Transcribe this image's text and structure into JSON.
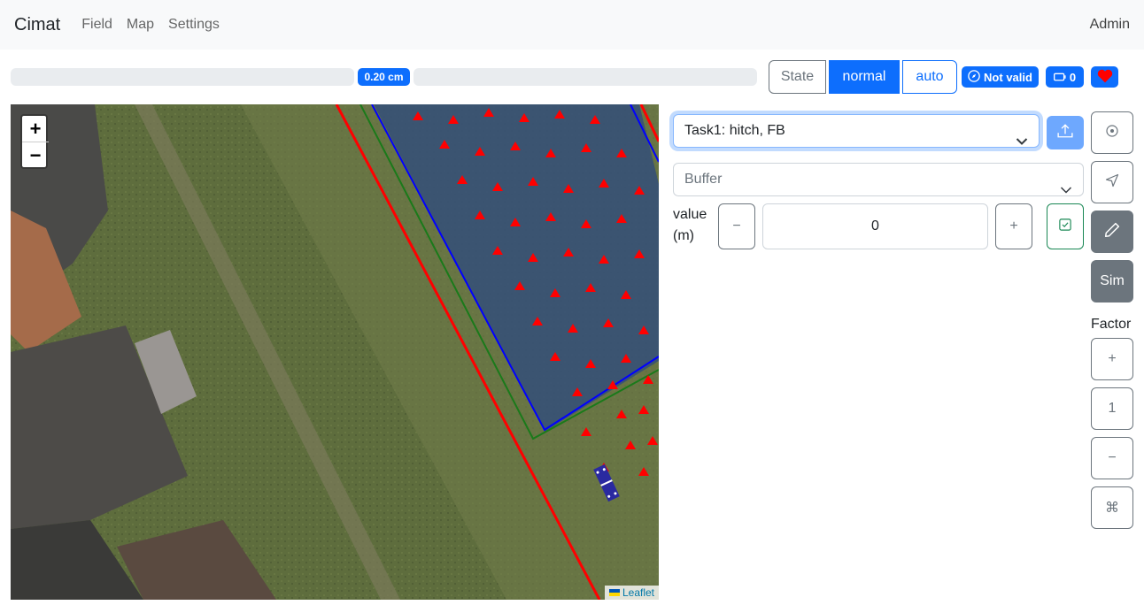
{
  "navbar": {
    "brand": "Cimat",
    "links": [
      "Field",
      "Map",
      "Settings"
    ],
    "user": "Admin"
  },
  "status": {
    "xtrack": "0.20 cm",
    "state_label": "State",
    "mode_normal": "normal",
    "mode_auto": "auto",
    "validity": "Not valid",
    "battery_count": "0"
  },
  "task_select": {
    "value": "Task1: hitch, FB"
  },
  "mode_select": {
    "value": "Buffer"
  },
  "value_control": {
    "label_line1": "value",
    "label_line2": "(m)",
    "minus": "−",
    "value": "0",
    "plus": "+"
  },
  "side": {
    "sim_label": "Sim",
    "factor_label": "Factor",
    "factor_plus": "+",
    "factor_value": "1",
    "factor_minus": "−",
    "command_symbol": "⌘"
  },
  "map": {
    "zoom_in": "+",
    "zoom_out": "−",
    "attribution": "Leaflet"
  },
  "colors": {
    "primary": "#0d6efd",
    "secondary": "#6c757d",
    "success": "#198754",
    "boundary_red": "#ff0000",
    "boundary_green": "#1a7a1a",
    "field_blue": "#0000ff",
    "heart": "#ff0000"
  },
  "icons": [
    "upload-icon",
    "target-icon",
    "navigation-icon",
    "pencil-icon",
    "check-square-icon",
    "compass-icon",
    "battery-icon",
    "heart-icon",
    "chevron-down-icon"
  ]
}
